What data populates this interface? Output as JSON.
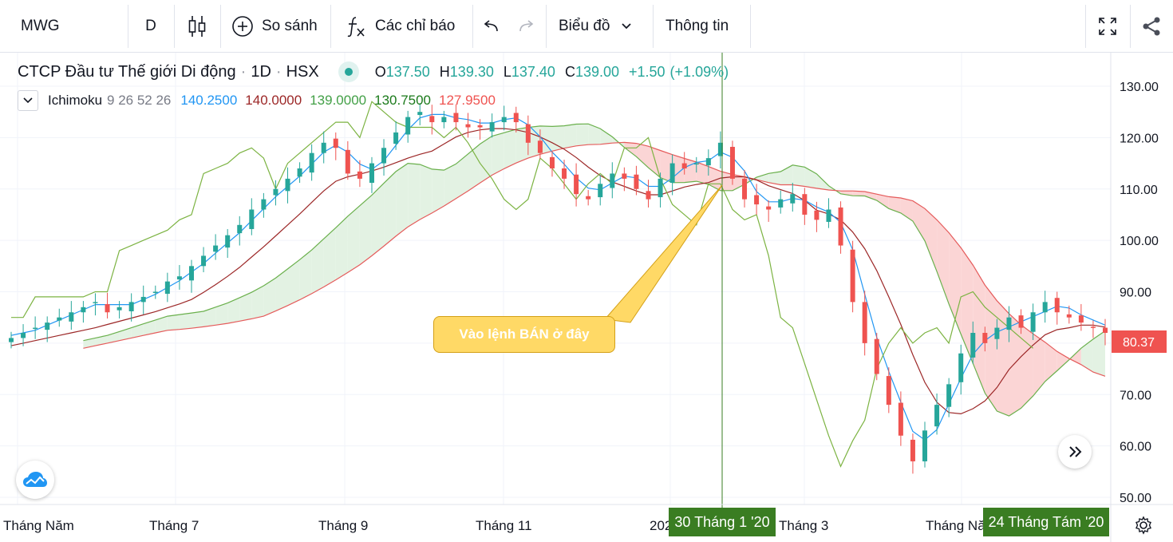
{
  "toolbar": {
    "symbol": "MWG",
    "interval": "D",
    "compare_label": "So sánh",
    "indicators_label": "Các chỉ báo",
    "chart_type_label": "Biểu đồ",
    "info_label": "Thông tin"
  },
  "legend": {
    "title": "CTCP Đầu tư Thế giới Di động",
    "interval": "1D",
    "exchange": "HSX",
    "o_label": "O",
    "o_value": "137.50",
    "h_label": "H",
    "h_value": "139.30",
    "l_label": "L",
    "l_value": "137.40",
    "c_label": "C",
    "c_value": "139.00",
    "change": "+1.50",
    "change_pct": "(+1.09%)",
    "indicator_name": "Ichimoku",
    "indicator_params": "9 26 52 26",
    "ind_v1": "140.2500",
    "ind_v2": "140.0000",
    "ind_v3": "139.0000",
    "ind_v4": "130.7500",
    "ind_v5": "127.9500"
  },
  "price_axis": [
    "130.00",
    "120.00",
    "110.00",
    "100.00",
    "90.00",
    "80.00",
    "70.00",
    "60.00",
    "50.00"
  ],
  "last_price": "80.37",
  "time_axis": [
    "Tháng Năm",
    "Tháng 7",
    "Tháng 9",
    "Tháng 11",
    "202",
    "Tháng 3",
    "Tháng Năm"
  ],
  "crosshair_date": "30 Tháng 1 '20",
  "end_date": "24 Tháng Tám '20",
  "annotation": "Vào lệnh BÁN ở đây",
  "colors": {
    "up": "#26a69a",
    "down": "#ef5350",
    "tenkan": "#2196f3",
    "kijun": "#9c2727",
    "chikou": "#43a047",
    "cloud_bull": "#e3f2e3",
    "cloud_bear": "#fbd5d5",
    "price_tag": "#ef5350",
    "crosshair_tag": "#3a7d22",
    "annotation_fill": "#ffd966"
  },
  "chart_data": {
    "type": "candlestick",
    "ylim": [
      48,
      136
    ],
    "close_series": [
      81,
      82,
      83,
      84,
      85,
      86,
      87,
      88,
      86,
      87,
      88,
      89,
      90,
      92,
      93,
      95,
      97,
      99,
      101,
      103,
      106,
      108,
      110,
      112,
      114,
      117,
      119,
      118,
      113,
      112,
      115,
      118,
      121,
      124,
      125,
      123,
      124,
      123,
      122,
      122,
      123,
      124,
      123,
      119,
      117,
      114,
      112,
      109,
      108,
      111,
      113,
      112,
      110,
      108,
      112,
      115,
      114,
      115,
      116,
      119,
      112,
      108,
      107,
      106,
      108,
      109,
      105,
      104,
      106,
      99,
      88,
      80,
      74,
      68,
      62,
      57,
      63,
      68,
      72,
      78,
      82,
      80,
      83,
      85,
      83,
      86,
      88,
      86,
      85,
      84,
      83,
      82
    ],
    "markers": {
      "crosshair_index": 62,
      "last_value": 80.37
    }
  }
}
